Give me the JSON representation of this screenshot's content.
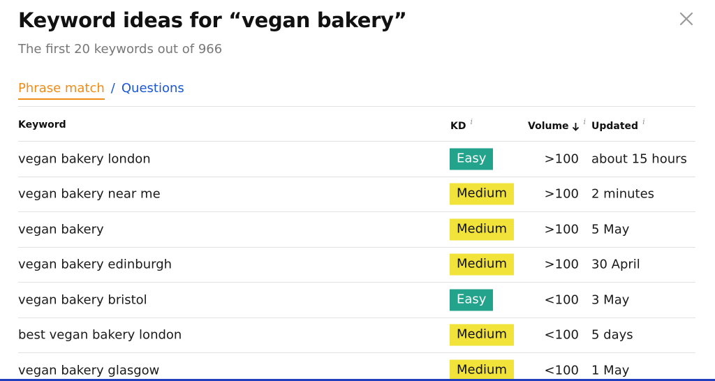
{
  "header": {
    "title": "Keyword ideas for “vegan bakery”",
    "subtitle": "The first 20 keywords out of 966"
  },
  "tabs": {
    "phrase_match": "Phrase match",
    "separator": "/",
    "questions": "Questions"
  },
  "table": {
    "columns": {
      "keyword": "Keyword",
      "kd": "KD",
      "volume": "Volume",
      "updated": "Updated",
      "info_glyph": "i"
    },
    "rows": [
      {
        "keyword": "vegan bakery london",
        "kd": "Easy",
        "volume": ">100",
        "updated": "about 15 hours"
      },
      {
        "keyword": "vegan bakery near me",
        "kd": "Medium",
        "volume": ">100",
        "updated": "2 minutes"
      },
      {
        "keyword": "vegan bakery",
        "kd": "Medium",
        "volume": ">100",
        "updated": "5 May"
      },
      {
        "keyword": "vegan bakery edinburgh",
        "kd": "Medium",
        "volume": ">100",
        "updated": "30 April"
      },
      {
        "keyword": "vegan bakery bristol",
        "kd": "Easy",
        "volume": "<100",
        "updated": "3 May"
      },
      {
        "keyword": "best vegan bakery london",
        "kd": "Medium",
        "volume": "<100",
        "updated": "5 days"
      },
      {
        "keyword": "vegan bakery glasgow",
        "kd": "Medium",
        "volume": "<100",
        "updated": "1 May"
      }
    ]
  },
  "colors": {
    "easy": "#23a38c",
    "medium": "#f2e33a",
    "active_tab": "#f08c1a",
    "link": "#1a56d6"
  },
  "icons": {
    "close": "close-icon",
    "sort": "arrow-down-icon",
    "info": "info-icon"
  }
}
